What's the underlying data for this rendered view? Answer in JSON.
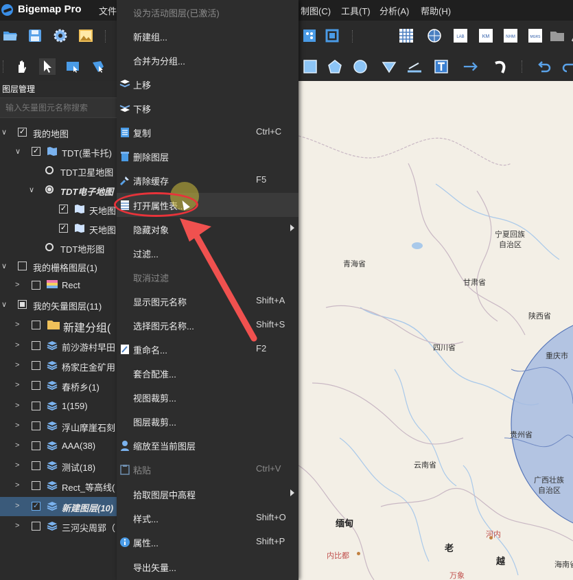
{
  "app": {
    "title": "Bigemap Pro"
  },
  "menubar": {
    "items": [
      "文件",
      "制图(C)",
      "工具(T)",
      "分析(A)",
      "帮助(H)"
    ]
  },
  "toolbar": {
    "grid_label": "网格",
    "icons": [
      "open-folder-icon",
      "save-icon",
      "settings-icon",
      "image-icon",
      "grid-icon",
      "globe-icon",
      "lkm-icon",
      "km-icon",
      "nhm-icon",
      "mgrs-icon",
      "folder-icon",
      "brush-icon"
    ],
    "grid_units": [
      "LAB",
      "KM",
      "NHM",
      "MGRS"
    ]
  },
  "layer_panel": {
    "title": "图层管理",
    "search_placeholder": "输入矢量图元名称搜索",
    "tree": [
      {
        "label": "我的地图",
        "checked": true
      },
      {
        "label": "TDT(墨卡托)",
        "checked": true
      },
      {
        "label": "TDT卫星地图",
        "radio": false
      },
      {
        "label": "TDT电子地图",
        "radio": true
      },
      {
        "label": "天地图",
        "checked": true
      },
      {
        "label": "天地图",
        "checked": true
      },
      {
        "label": "TDT地形图",
        "radio": false
      },
      {
        "label": "我的栅格图层(1)",
        "checked": false
      },
      {
        "label": "Rect",
        "checked": false
      },
      {
        "label": "我的矢量图层(11)",
        "checked": "partial"
      },
      {
        "label": "新建分组(",
        "checked": false
      },
      {
        "label": "前沙游村早田",
        "checked": false
      },
      {
        "label": "杨家庄金矿用",
        "checked": false
      },
      {
        "label": "春桥乡(1)",
        "checked": false
      },
      {
        "label": "1(159)",
        "checked": false
      },
      {
        "label": "浮山摩崖石刻",
        "checked": false
      },
      {
        "label": "AAA(38)",
        "checked": false
      },
      {
        "label": "测试(18)",
        "checked": false
      },
      {
        "label": "Rect_等高线(",
        "checked": false
      },
      {
        "label": "新建图层(10)",
        "checked": true,
        "selected": true
      },
      {
        "label": "三河尖周郢（",
        "checked": false
      }
    ]
  },
  "context_menu": {
    "items": [
      {
        "label": "设为活动图层(已激活)",
        "disabled": true
      },
      {
        "label": "新建组..."
      },
      {
        "label": "合并为分组..."
      },
      {
        "label": "上移",
        "icon": "move-up-icon"
      },
      {
        "label": "下移",
        "icon": "move-down-icon"
      },
      {
        "label": "复制",
        "icon": "copy-icon",
        "shortcut": "Ctrl+C"
      },
      {
        "label": "删除图层",
        "icon": "trash-icon"
      },
      {
        "label": "清除缓存",
        "icon": "broom-icon",
        "shortcut": "F5"
      },
      {
        "label": "打开属性表...",
        "icon": "table-icon",
        "hover": true
      },
      {
        "label": "隐藏对象",
        "submenu": true
      },
      {
        "label": "过滤..."
      },
      {
        "label": "取消过滤",
        "disabled": true
      },
      {
        "label": "显示图元名称",
        "shortcut": "Shift+A"
      },
      {
        "label": "选择图元名称...",
        "shortcut": "Shift+S"
      },
      {
        "label": "重命名...",
        "icon": "rename-icon",
        "shortcut": "F2"
      },
      {
        "label": "套合配准..."
      },
      {
        "label": "视图裁剪..."
      },
      {
        "label": "图层裁剪..."
      },
      {
        "label": "缩放至当前图层",
        "icon": "user-icon"
      },
      {
        "label": "粘贴",
        "icon": "paste-icon",
        "shortcut": "Ctrl+V",
        "disabled": true
      },
      {
        "label": "拾取图层中高程",
        "submenu": true
      },
      {
        "label": "样式...",
        "shortcut": "Shift+O"
      },
      {
        "label": "属性...",
        "icon": "info-icon",
        "shortcut": "Shift+P"
      },
      {
        "label": "导出矢量..."
      }
    ]
  },
  "map": {
    "labels": [
      "宁夏回族",
      "自治区",
      "青海省",
      "甘肃省",
      "陕西省",
      "四川省",
      "重庆市",
      "贵州省",
      "云南省",
      "广西壮族",
      "自治区",
      "缅甸",
      "河内",
      "内比都",
      "老",
      "越",
      "万象",
      "海南省"
    ]
  },
  "colors": {
    "accent": "#3a8ee6",
    "highlight": "#e8333a",
    "selected_row": "#3a5a7a",
    "map_bg": "#f3efe6",
    "circle_fill": "#a7bce0"
  }
}
